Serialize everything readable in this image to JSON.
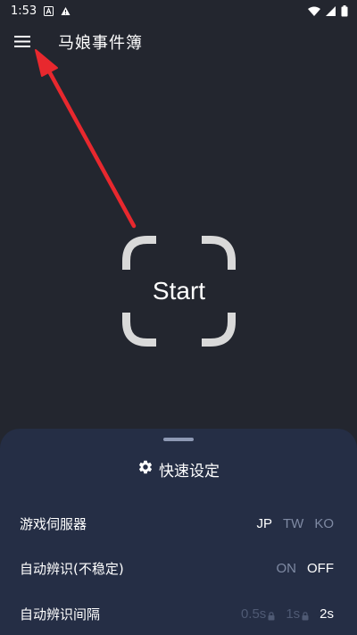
{
  "status_bar": {
    "time": "1:53",
    "icons": [
      "notification-a-icon",
      "warning-icon",
      "wifi-icon",
      "signal-icon",
      "battery-icon"
    ]
  },
  "app_bar": {
    "title": "马娘事件簿",
    "menu_icon": "hamburger-menu-icon"
  },
  "main": {
    "start_label": "Start"
  },
  "quick_settings": {
    "title": "快速设定",
    "title_icon": "gear-icon",
    "rows": [
      {
        "label": "游戏伺服器",
        "options": [
          "JP",
          "TW",
          "KO"
        ],
        "selected": "JP"
      },
      {
        "label": "自动辨识(不稳定)",
        "options": [
          "ON",
          "OFF"
        ],
        "selected": "OFF"
      },
      {
        "label": "自动辨识间隔",
        "options": [
          "0.5s",
          "1s",
          "2s"
        ],
        "selected": "2s",
        "locked": [
          "0.5s",
          "1s"
        ]
      }
    ]
  },
  "colors": {
    "background": "#23262f",
    "sheet": "#252e45",
    "arrow": "#e8282e",
    "frame": "#d9d9d9",
    "inactive_option": "#7f8aa3"
  }
}
